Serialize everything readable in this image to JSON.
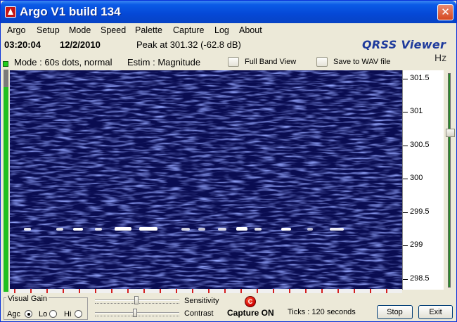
{
  "window": {
    "title": "Argo V1 build 134",
    "close_glyph": "✕"
  },
  "menu": [
    "Argo",
    "Setup",
    "Mode",
    "Speed",
    "Palette",
    "Capture",
    "Log",
    "About"
  ],
  "info": {
    "time": "03:20:04",
    "date": "12/2/2010",
    "peak": "Peak at  301.32 (-62.8 dB)",
    "brand": "QRSS Viewer"
  },
  "modebar": {
    "mode": "Mode : 60s dots, normal",
    "estim": "Estim : Magnitude",
    "full_band": "Full Band View",
    "save_wav": "Save to WAV file",
    "unit": "Hz"
  },
  "scale": {
    "labels": [
      "301.5",
      "301",
      "300.5",
      "300",
      "299.5",
      "299",
      "298.5"
    ]
  },
  "level": {
    "fraction": 0.92
  },
  "bottom": {
    "visual_gain": "Visual Gain",
    "agc": "Agc",
    "lo": "Lo",
    "hi": "Hi",
    "sensitivity": "Sensitivity",
    "contrast": "Contrast",
    "capture_icon": "C",
    "capture_status": "Capture ON",
    "ticks": "Ticks   : 120 seconds",
    "stop": "Stop",
    "exit": "Exit"
  },
  "colors": {
    "waterfall_bg": "#0a0d52",
    "signal": "#ffffff",
    "title_bar": "#0548d6",
    "level_green": "#20c020"
  }
}
